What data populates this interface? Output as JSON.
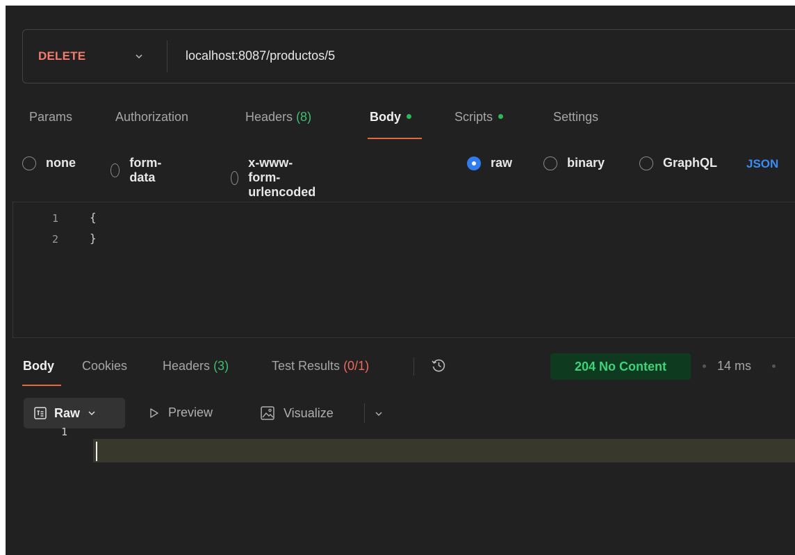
{
  "request": {
    "method": "DELETE",
    "url": "localhost:8087/productos/5"
  },
  "request_tabs": {
    "params": "Params",
    "authorization": "Authorization",
    "headers_label": "Headers",
    "headers_count": "(8)",
    "body": "Body",
    "scripts": "Scripts",
    "settings": "Settings",
    "active": "Body"
  },
  "body_modes": {
    "none": "none",
    "form_data": "form-data",
    "urlencoded": "x-www-form-urlencoded",
    "raw": "raw",
    "binary": "binary",
    "graphql": "GraphQL",
    "selected": "raw",
    "language": "JSON"
  },
  "request_body": {
    "lines": [
      {
        "number": "1",
        "text": "{"
      },
      {
        "number": "2",
        "text": "}"
      }
    ]
  },
  "response_tabs": {
    "body": "Body",
    "cookies": "Cookies",
    "headers_label": "Headers",
    "headers_count": "(3)",
    "test_results_label": "Test Results",
    "test_results_count": "(0/1)",
    "active": "Body"
  },
  "response_meta": {
    "status": "204 No Content",
    "time": "14 ms"
  },
  "response_toolbar": {
    "format": "Raw",
    "preview": "Preview",
    "visualize": "Visualize"
  },
  "response_body": {
    "lines": [
      {
        "number": "1",
        "text": ""
      }
    ]
  },
  "colors": {
    "background": "#212121",
    "method_delete": "#f47c6f",
    "accent_orange": "#e5693d",
    "radio_selected": "#2f7cf0",
    "json_label": "#3a8cf5",
    "status_bg": "#0e3b1f",
    "status_text": "#3fd27a"
  }
}
